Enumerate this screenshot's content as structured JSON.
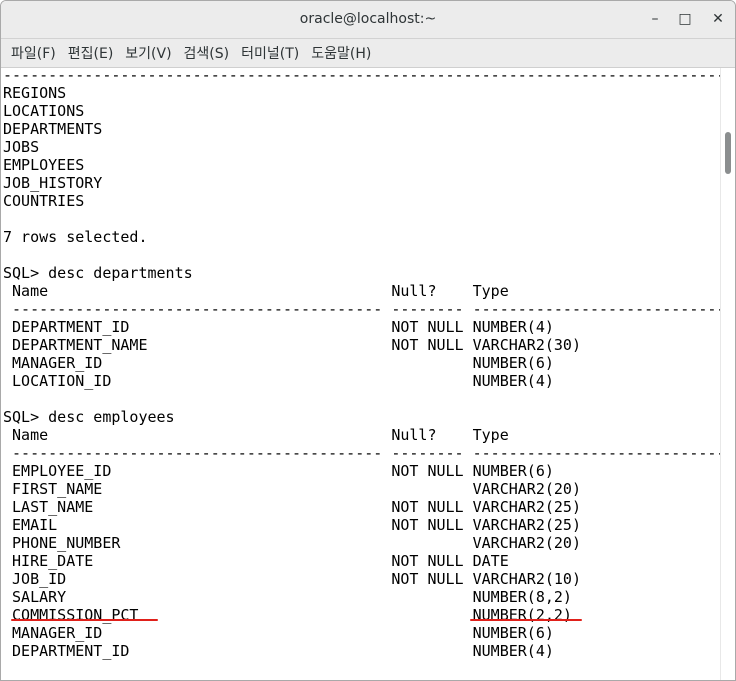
{
  "window": {
    "title": "oracle@localhost:~"
  },
  "window_controls": {
    "minimize": "–",
    "maximize": "□",
    "close": "✕"
  },
  "menu": [
    "파일(F)",
    "편집(E)",
    "보기(V)",
    "검색(S)",
    "터미널(T)",
    "도움말(H)"
  ],
  "terminal": {
    "lines": [
      "--------------------------------------------------------------------------------",
      "REGIONS",
      "LOCATIONS",
      "DEPARTMENTS",
      "JOBS",
      "EMPLOYEES",
      "JOB_HISTORY",
      "COUNTRIES",
      "",
      "7 rows selected.",
      "",
      "SQL> desc departments",
      " Name                                      Null?    Type",
      " ----------------------------------------- -------- ----------------------------",
      " DEPARTMENT_ID                             NOT NULL NUMBER(4)",
      " DEPARTMENT_NAME                           NOT NULL VARCHAR2(30)",
      " MANAGER_ID                                         NUMBER(6)",
      " LOCATION_ID                                        NUMBER(4)",
      "",
      "SQL> desc employees",
      " Name                                      Null?    Type",
      " ----------------------------------------- -------- ----------------------------",
      " EMPLOYEE_ID                               NOT NULL NUMBER(6)",
      " FIRST_NAME                                         VARCHAR2(20)",
      " LAST_NAME                                 NOT NULL VARCHAR2(25)",
      " EMAIL                                     NOT NULL VARCHAR2(25)",
      " PHONE_NUMBER                                       VARCHAR2(20)",
      " HIRE_DATE                                 NOT NULL DATE",
      " JOB_ID                                    NOT NULL VARCHAR2(10)",
      " SALARY                                             NUMBER(8,2)",
      " COMMISSION_PCT                                     NUMBER(2,2)",
      " MANAGER_ID                                         NUMBER(6)",
      " DEPARTMENT_ID                                      NUMBER(4)"
    ]
  },
  "colors": {
    "annotation_underline": "#e0201a"
  }
}
